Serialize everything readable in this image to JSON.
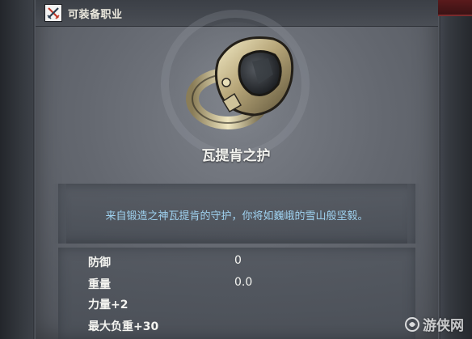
{
  "header": {
    "equip_label": "可装备职业",
    "icon": "crossed-swords-icon"
  },
  "item": {
    "name": "瓦提肯之护",
    "description": "来自锻造之神瓦提肯的守护，你将如巍峨的雪山般坚毅。",
    "icon": "ring-icon"
  },
  "stats": [
    {
      "label": "防御",
      "value": "0"
    },
    {
      "label": "重量",
      "value": "0.0"
    },
    {
      "label": "力量+2",
      "value": ""
    },
    {
      "label": "最大负重+30",
      "value": ""
    }
  ],
  "watermark": {
    "text": "游侠网"
  },
  "colors": {
    "description_text": "#9fd2f0",
    "corner_accent": "#7a2a2c"
  }
}
